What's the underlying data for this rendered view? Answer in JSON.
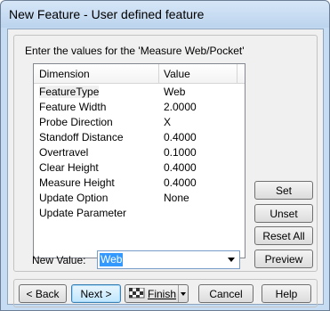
{
  "window": {
    "title": "New Feature - User defined feature"
  },
  "prompt": "Enter the values for the 'Measure Web/Pocket'",
  "table": {
    "columns": [
      "Dimension",
      "Value"
    ],
    "rows": [
      {
        "dimension": "FeatureType",
        "value": "Web"
      },
      {
        "dimension": "Feature Width",
        "value": "2.0000"
      },
      {
        "dimension": "Probe Direction",
        "value": "X"
      },
      {
        "dimension": "Standoff Distance",
        "value": "0.4000"
      },
      {
        "dimension": "Overtravel",
        "value": "0.1000"
      },
      {
        "dimension": "Clear Height",
        "value": "0.4000"
      },
      {
        "dimension": "Measure Height",
        "value": "0.4000"
      },
      {
        "dimension": "Update Option",
        "value": "None"
      },
      {
        "dimension": "Update Parameter",
        "value": ""
      }
    ]
  },
  "side_buttons": {
    "set": "Set",
    "unset": "Unset",
    "reset_all": "Reset All",
    "preview": "Preview"
  },
  "new_value": {
    "label": "New Value:",
    "value": "Web"
  },
  "bottom_buttons": {
    "back": "< Back",
    "next": "Next >",
    "finish": "Finish",
    "cancel": "Cancel",
    "help": "Help"
  },
  "icons": {
    "finish": "checkered-flag-icon",
    "dropdown": "chevron-down-icon"
  }
}
